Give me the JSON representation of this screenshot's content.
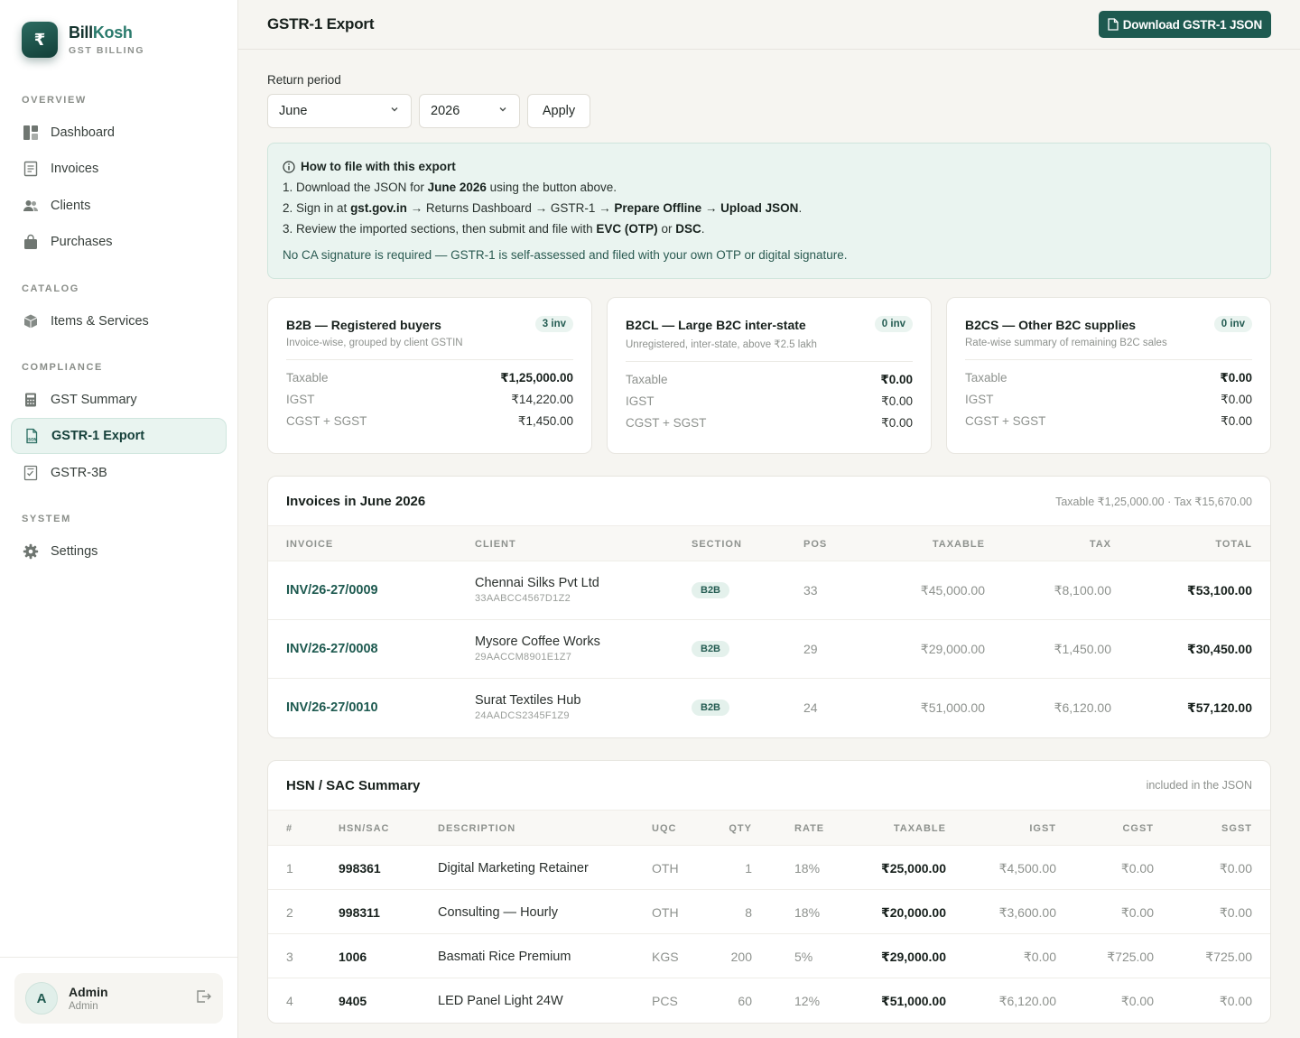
{
  "brand": {
    "logo_symbol": "₹",
    "name_part1": "Bill",
    "name_part2": "Kosh",
    "subtitle": "GST BILLING"
  },
  "sidebar": {
    "sections": [
      {
        "label": "OVERVIEW"
      },
      {
        "label": "CATALOG"
      },
      {
        "label": "COMPLIANCE"
      },
      {
        "label": "SYSTEM"
      }
    ],
    "items": [
      {
        "label": "Dashboard",
        "icon": "dashboard-icon"
      },
      {
        "label": "Invoices",
        "icon": "invoice-icon"
      },
      {
        "label": "Clients",
        "icon": "users-icon"
      },
      {
        "label": "Purchases",
        "icon": "bag-icon"
      },
      {
        "label": "Items & Services",
        "icon": "box-icon"
      },
      {
        "label": "GST Summary",
        "icon": "calculator-icon"
      },
      {
        "label": "GSTR-1 Export",
        "icon": "json-file-icon",
        "active": true
      },
      {
        "label": "GSTR-3B",
        "icon": "checklist-icon"
      },
      {
        "label": "Settings",
        "icon": "gear-icon"
      }
    ]
  },
  "user": {
    "initial": "A",
    "name": "Admin",
    "role": "Admin"
  },
  "header": {
    "title": "GSTR-1 Export",
    "download_label": "Download GSTR-1 JSON"
  },
  "filters": {
    "label": "Return period",
    "month": "June",
    "year": "2026",
    "apply_label": "Apply"
  },
  "info": {
    "title": "How to file with this export",
    "step1_pre": "1. Download the JSON for ",
    "step1_bold": "June 2026",
    "step1_post": " using the button above.",
    "step2_pre": "2. Sign in at ",
    "step2_b1": "gst.gov.in",
    "step2_mid": " → Returns Dashboard → GSTR-1 → ",
    "step2_b2": "Prepare Offline → Upload JSON",
    "step2_post": ".",
    "step3_pre": "3. Review the imported sections, then submit and file with ",
    "step3_b1": "EVC (OTP)",
    "step3_mid": " or ",
    "step3_b2": "DSC",
    "step3_post": ".",
    "note": "No CA signature is required — GSTR-1 is self-assessed and filed with your own OTP or digital signature."
  },
  "cards": [
    {
      "title": "B2B — Registered buyers",
      "badge": "3 inv",
      "subtitle": "Invoice-wise, grouped by client GSTIN",
      "taxable_label": "Taxable",
      "taxable": "₹1,25,000.00",
      "igst_label": "IGST",
      "igst": "₹14,220.00",
      "cgst_label": "CGST + SGST",
      "cgst": "₹1,450.00"
    },
    {
      "title": "B2CL — Large B2C inter-state",
      "badge": "0 inv",
      "subtitle": "Unregistered, inter-state, above ₹2.5 lakh",
      "taxable_label": "Taxable",
      "taxable": "₹0.00",
      "igst_label": "IGST",
      "igst": "₹0.00",
      "cgst_label": "CGST + SGST",
      "cgst": "₹0.00"
    },
    {
      "title": "B2CS — Other B2C supplies",
      "badge": "0 inv",
      "subtitle": "Rate-wise summary of remaining B2C sales",
      "taxable_label": "Taxable",
      "taxable": "₹0.00",
      "igst_label": "IGST",
      "igst": "₹0.00",
      "cgst_label": "CGST + SGST",
      "cgst": "₹0.00"
    }
  ],
  "invoices": {
    "title": "Invoices in June 2026",
    "meta": "Taxable ₹1,25,000.00 · Tax ₹15,670.00",
    "columns": {
      "invoice": "INVOICE",
      "client": "CLIENT",
      "section": "SECTION",
      "pos": "POS",
      "taxable": "TAXABLE",
      "tax": "TAX",
      "total": "TOTAL"
    },
    "rows": [
      {
        "invoice": "INV/26-27/0009",
        "client": "Chennai Silks Pvt Ltd",
        "gstin": "33AABCC4567D1Z2",
        "section": "B2B",
        "pos": "33",
        "taxable": "₹45,000.00",
        "tax": "₹8,100.00",
        "total": "₹53,100.00"
      },
      {
        "invoice": "INV/26-27/0008",
        "client": "Mysore Coffee Works",
        "gstin": "29AACCM8901E1Z7",
        "section": "B2B",
        "pos": "29",
        "taxable": "₹29,000.00",
        "tax": "₹1,450.00",
        "total": "₹30,450.00"
      },
      {
        "invoice": "INV/26-27/0010",
        "client": "Surat Textiles Hub",
        "gstin": "24AADCS2345F1Z9",
        "section": "B2B",
        "pos": "24",
        "taxable": "₹51,000.00",
        "tax": "₹6,120.00",
        "total": "₹57,120.00"
      }
    ]
  },
  "hsn": {
    "title": "HSN / SAC Summary",
    "meta": "included in the JSON",
    "columns": {
      "num": "#",
      "code": "HSN/SAC",
      "desc": "DESCRIPTION",
      "uqc": "UQC",
      "qty": "QTY",
      "rate": "RATE",
      "taxable": "TAXABLE",
      "igst": "IGST",
      "cgst": "CGST",
      "sgst": "SGST"
    },
    "rows": [
      {
        "num": "1",
        "code": "998361",
        "desc": "Digital Marketing Retainer",
        "uqc": "OTH",
        "qty": "1",
        "rate": "18%",
        "taxable": "₹25,000.00",
        "igst": "₹4,500.00",
        "cgst": "₹0.00",
        "sgst": "₹0.00"
      },
      {
        "num": "2",
        "code": "998311",
        "desc": "Consulting — Hourly",
        "uqc": "OTH",
        "qty": "8",
        "rate": "18%",
        "taxable": "₹20,000.00",
        "igst": "₹3,600.00",
        "cgst": "₹0.00",
        "sgst": "₹0.00"
      },
      {
        "num": "3",
        "code": "1006",
        "desc": "Basmati Rice Premium",
        "uqc": "KGS",
        "qty": "200",
        "rate": "5%",
        "taxable": "₹29,000.00",
        "igst": "₹0.00",
        "cgst": "₹725.00",
        "sgst": "₹725.00"
      },
      {
        "num": "4",
        "code": "9405",
        "desc": "LED Panel Light 24W",
        "uqc": "PCS",
        "qty": "60",
        "rate": "12%",
        "taxable": "₹51,000.00",
        "igst": "₹6,120.00",
        "cgst": "₹0.00",
        "sgst": "₹0.00"
      }
    ]
  },
  "colors": {
    "accent": "#1e5a50",
    "accent_light": "#eaf4f0",
    "background": "#f6f5f1"
  }
}
